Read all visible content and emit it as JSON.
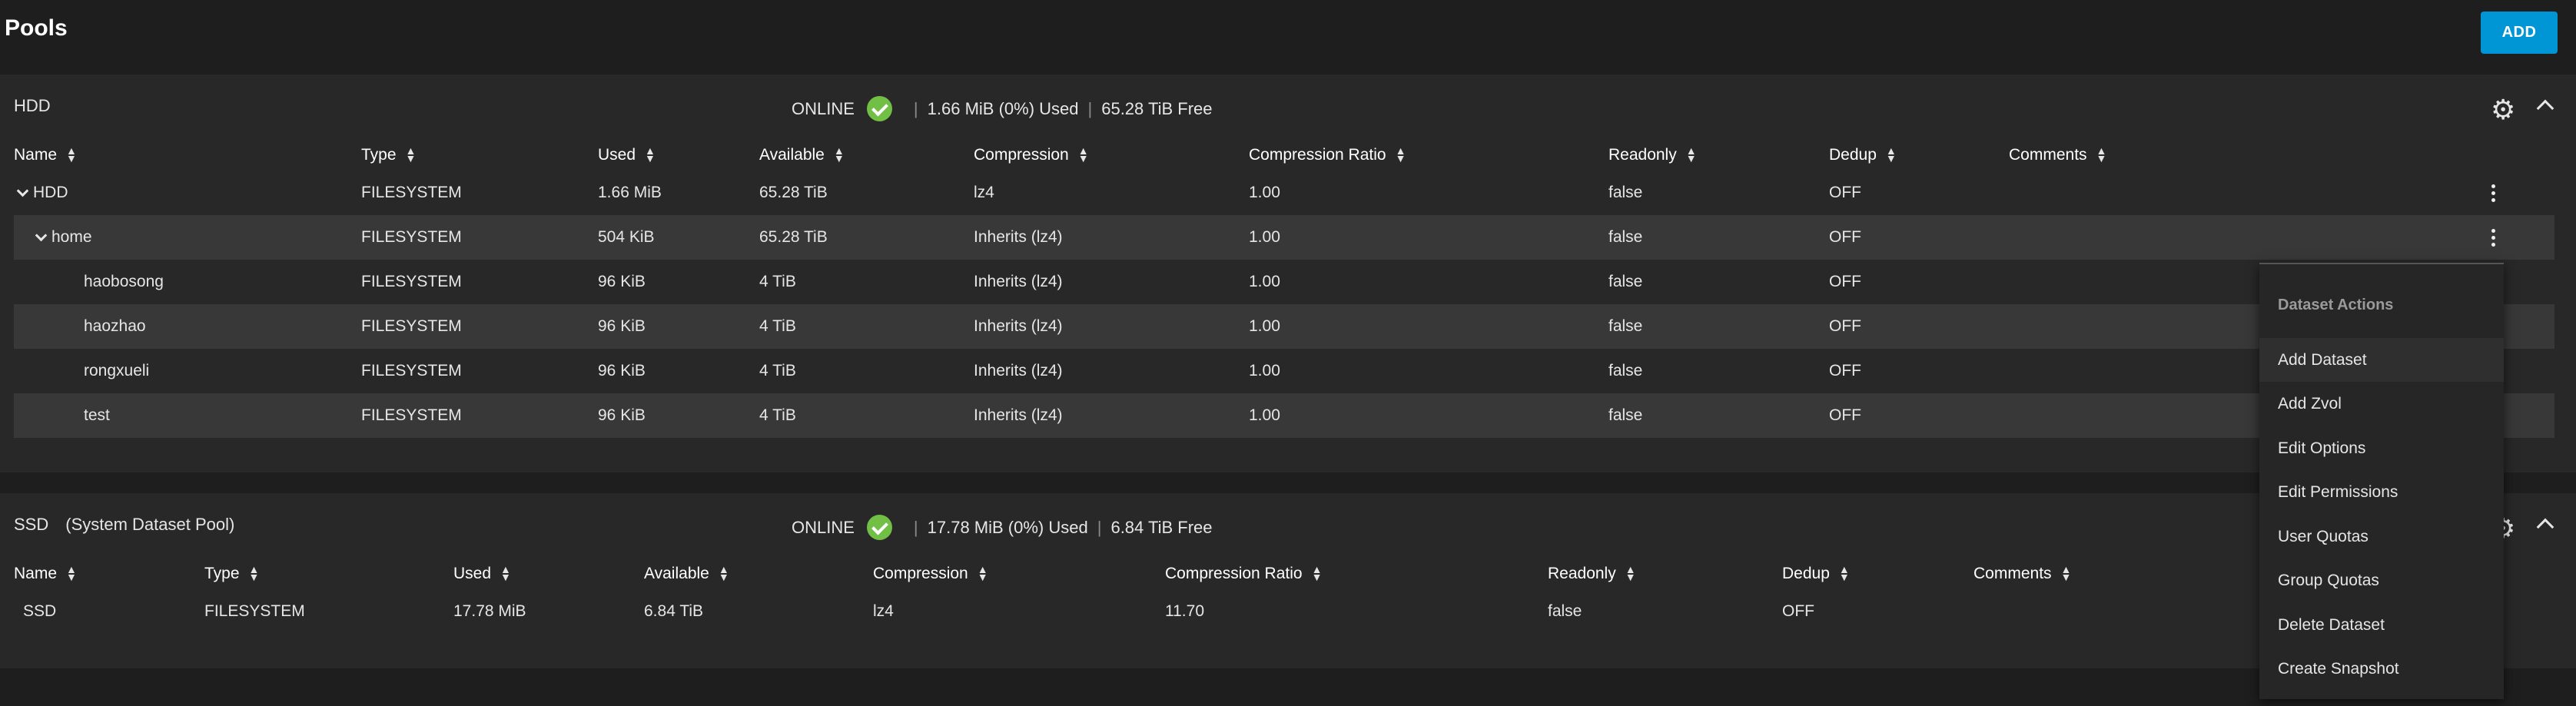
{
  "page": {
    "title": "Pools",
    "add_label": "ADD"
  },
  "columns_hdd": [
    "Name",
    "Type",
    "Used",
    "Available",
    "Compression",
    "Compression Ratio",
    "Readonly",
    "Dedup",
    "Comments"
  ],
  "columns_ssd": [
    "Name",
    "Type",
    "Used",
    "Available",
    "Compression",
    "Compression Ratio",
    "Readonly",
    "Dedup",
    "Comments"
  ],
  "hdd": {
    "name": "HDD",
    "status": "ONLINE",
    "used": "1.66 MiB (0%) Used",
    "free": "65.28 TiB Free",
    "rows": [
      {
        "name": "HDD",
        "type": "FILESYSTEM",
        "used": "1.66 MiB",
        "available": "65.28 TiB",
        "compression": "lz4",
        "ratio": "1.00",
        "readonly": "false",
        "dedup": "OFF"
      },
      {
        "name": "home",
        "type": "FILESYSTEM",
        "used": "504 KiB",
        "available": "65.28 TiB",
        "compression": "Inherits (lz4)",
        "ratio": "1.00",
        "readonly": "false",
        "dedup": "OFF"
      },
      {
        "name": "haobosong",
        "type": "FILESYSTEM",
        "used": "96 KiB",
        "available": "4 TiB",
        "compression": "Inherits (lz4)",
        "ratio": "1.00",
        "readonly": "false",
        "dedup": "OFF"
      },
      {
        "name": "haozhao",
        "type": "FILESYSTEM",
        "used": "96 KiB",
        "available": "4 TiB",
        "compression": "Inherits (lz4)",
        "ratio": "1.00",
        "readonly": "false",
        "dedup": "OFF"
      },
      {
        "name": "rongxueli",
        "type": "FILESYSTEM",
        "used": "96 KiB",
        "available": "4 TiB",
        "compression": "Inherits (lz4)",
        "ratio": "1.00",
        "readonly": "false",
        "dedup": "OFF"
      },
      {
        "name": "test",
        "type": "FILESYSTEM",
        "used": "96 KiB",
        "available": "4 TiB",
        "compression": "Inherits (lz4)",
        "ratio": "1.00",
        "readonly": "false",
        "dedup": "OFF"
      }
    ]
  },
  "ssd": {
    "name": "SSD",
    "subtitle": "(System Dataset Pool)",
    "status": "ONLINE",
    "used": "17.78 MiB (0%) Used",
    "free": "6.84 TiB Free",
    "rows": [
      {
        "name": "SSD",
        "type": "FILESYSTEM",
        "used": "17.78 MiB",
        "available": "6.84 TiB",
        "compression": "lz4",
        "ratio": "11.70",
        "readonly": "false",
        "dedup": "OFF"
      }
    ]
  },
  "menu": {
    "title": "Dataset Actions",
    "items": [
      "Add Dataset",
      "Add Zvol",
      "Edit Options",
      "Edit Permissions",
      "User Quotas",
      "Group Quotas",
      "Delete Dataset",
      "Create Snapshot"
    ]
  },
  "icons": {
    "gear": "gear-icon",
    "collapse": "chevron-up-icon",
    "status": "check-circle-icon",
    "sort": "sort-icon",
    "more": "more-vert-icon"
  },
  "colors": {
    "accent": "#0095d5",
    "online": "#71bf44",
    "background": "#1e1e1e",
    "card": "#282828"
  }
}
